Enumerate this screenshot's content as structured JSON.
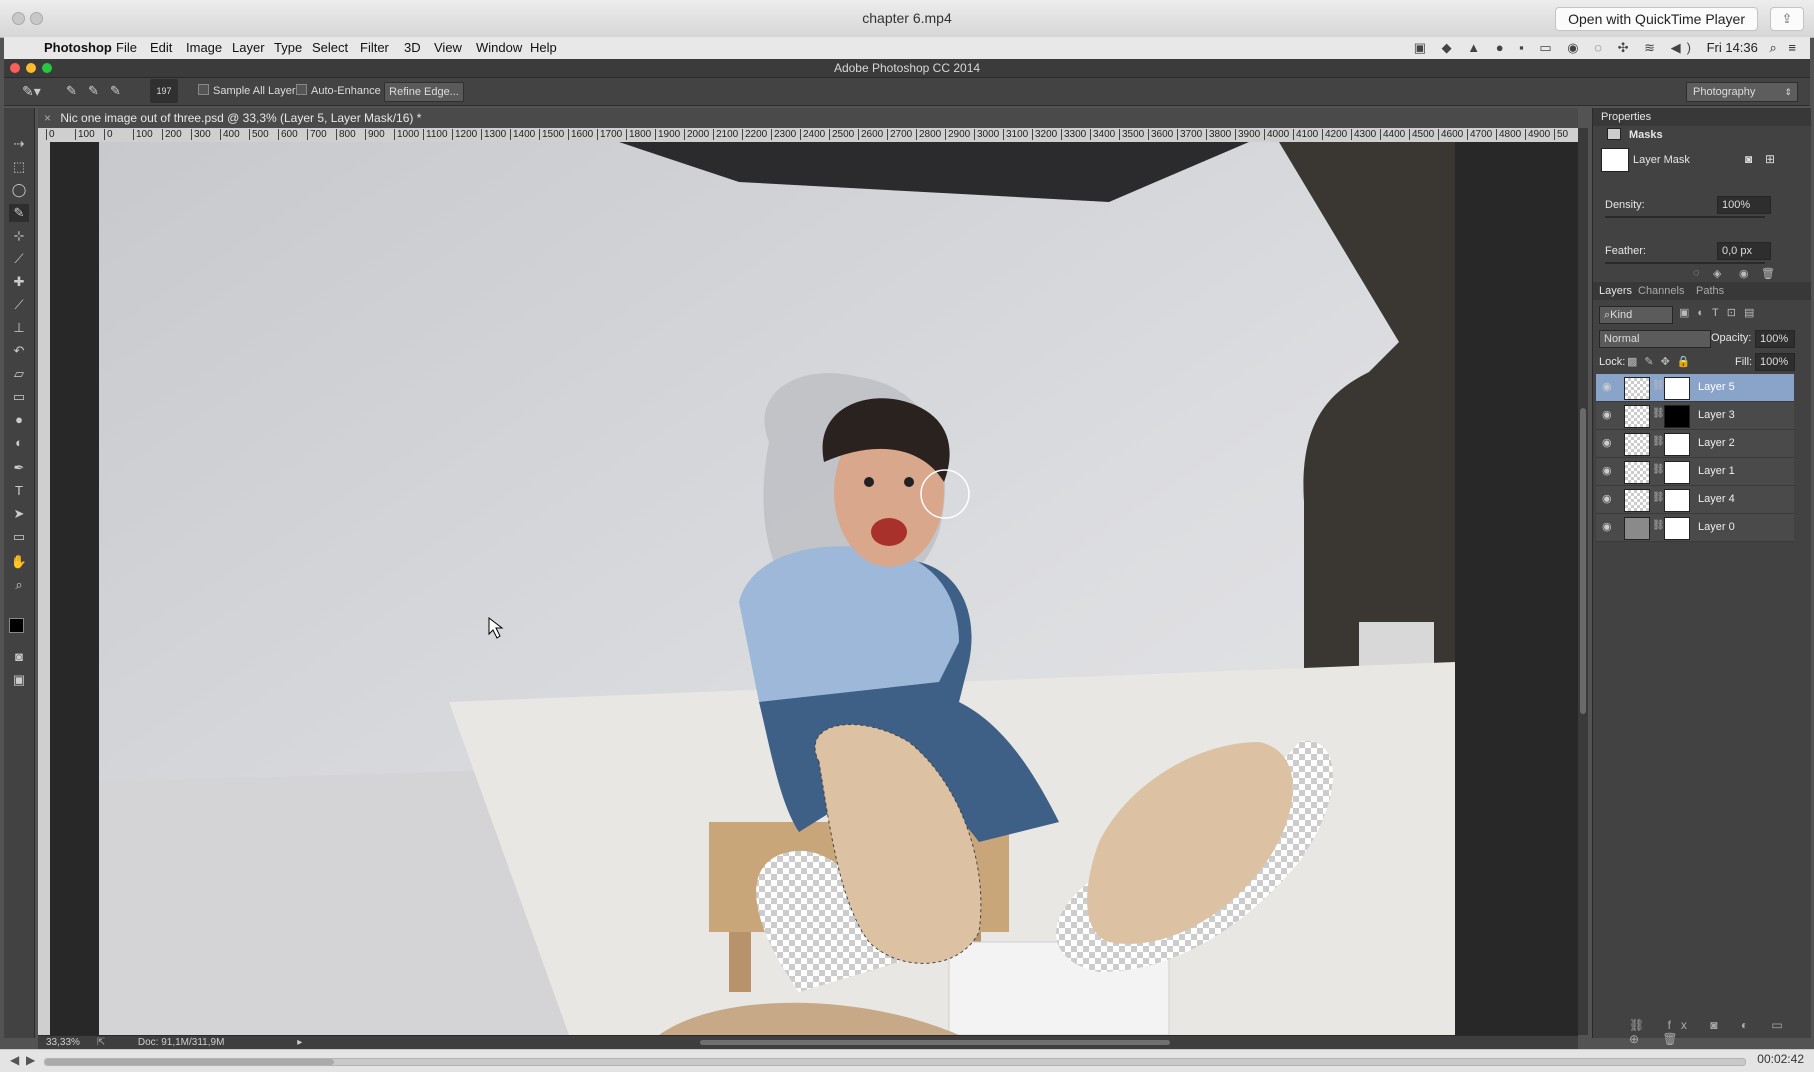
{
  "qt": {
    "title": "chapter 6.mp4",
    "open_button": "Open with QuickTime Player",
    "time": "00:02:42",
    "progress": 0.17
  },
  "menubar": {
    "app": "Photoshop",
    "items": [
      "File",
      "Edit",
      "Image",
      "Layer",
      "Type",
      "Select",
      "Filter",
      "3D",
      "View",
      "Window",
      "Help"
    ],
    "clock": "Fri 14:36"
  },
  "ps_title": "Adobe Photoshop CC 2014",
  "options": {
    "brush_size": "197",
    "sample_all_layers": "Sample All Layers",
    "auto_enhance": "Auto-Enhance",
    "refine_edge": "Refine Edge...",
    "workspace": "Photography"
  },
  "document": {
    "tab": "Nic one image out of three.psd @ 33,3% (Layer 5, Layer Mask/16) *",
    "ruler_ticks": [
      "0",
      "100",
      "0",
      "100",
      "200",
      "300",
      "400",
      "500",
      "600",
      "700",
      "800",
      "900",
      "1000",
      "1100",
      "1200",
      "1300",
      "1400",
      "1500",
      "1600",
      "1700",
      "1800",
      "1900",
      "2000",
      "2100",
      "2200",
      "2300",
      "2400",
      "2500",
      "2600",
      "2700",
      "2800",
      "2900",
      "3000",
      "3100",
      "3200",
      "3300",
      "3400",
      "3500",
      "3600",
      "3700",
      "3800",
      "3900",
      "4000",
      "4100",
      "4200",
      "4300",
      "4400",
      "4500",
      "4600",
      "4700",
      "4800",
      "4900",
      "50"
    ],
    "zoom": "33,33%",
    "doc_size": "Doc: 91,1M/311,9M"
  },
  "properties": {
    "tab": "Properties",
    "section": "Masks",
    "mask_label": "Layer Mask",
    "density_label": "Density:",
    "density_value": "100%",
    "feather_label": "Feather:",
    "feather_value": "0,0 px"
  },
  "layers_panel": {
    "tabs": [
      "Layers",
      "Channels",
      "Paths"
    ],
    "kind": "Kind",
    "blend_mode": "Normal",
    "opacity_label": "Opacity:",
    "opacity_value": "100%",
    "lock_label": "Lock:",
    "fill_label": "Fill:",
    "fill_value": "100%",
    "layers": [
      "Layer 5",
      "Layer 3",
      "Layer 2",
      "Layer 1",
      "Layer 4",
      "Layer 0"
    ]
  },
  "colors": {
    "ps_dark": "#424242",
    "selected_layer": "#8aa3c9",
    "photo_wall": "#d9dadd"
  }
}
